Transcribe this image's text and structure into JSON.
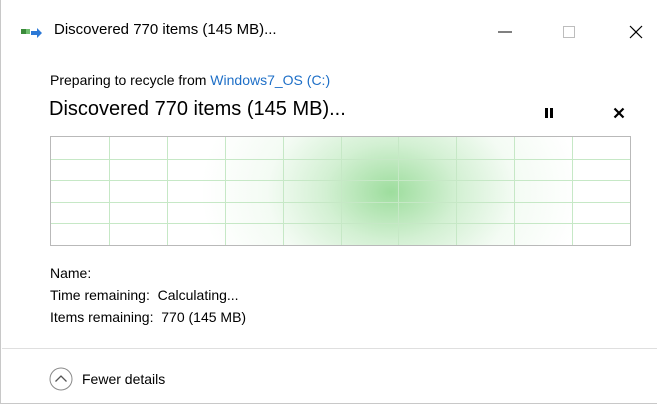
{
  "window": {
    "title": "Discovered 770 items (145 MB)...",
    "icon": "recycle-transfer-icon",
    "controls": {
      "minimize": "minimize-icon",
      "maximize": "maximize-icon",
      "close": "close-icon"
    }
  },
  "operation": {
    "subtitle_prefix": "Preparing to recycle from ",
    "subtitle_link": "Windows7_OS (C:)",
    "status": "Discovered 770 items (145 MB)...",
    "pause_icon": "pause-icon",
    "cancel_icon": "cancel-icon"
  },
  "details": {
    "name_label": "Name:",
    "time_label": "Time remaining:",
    "time_value": "Calculating...",
    "items_label": "Items remaining:",
    "items_value": "770 (145 MB)"
  },
  "footer": {
    "toggle_label": "Fewer details",
    "toggle_icon": "chevron-up-circle-icon"
  },
  "colors": {
    "link": "#1e6fc7",
    "graph_grid": "#c6e8c6",
    "graph_glow": "#8cd78c"
  }
}
